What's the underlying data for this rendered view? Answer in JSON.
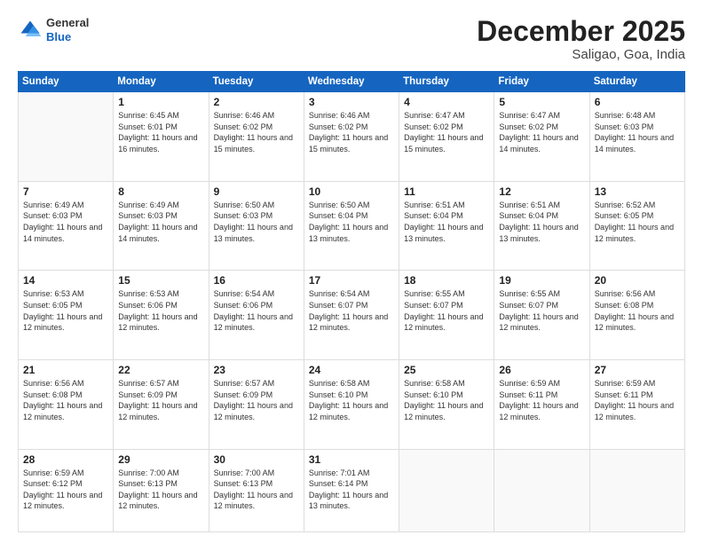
{
  "header": {
    "logo": {
      "general": "General",
      "blue": "Blue"
    },
    "title": "December 2025",
    "location": "Saligao, Goa, India"
  },
  "days_of_week": [
    "Sunday",
    "Monday",
    "Tuesday",
    "Wednesday",
    "Thursday",
    "Friday",
    "Saturday"
  ],
  "weeks": [
    [
      {
        "day": "",
        "sunrise": "",
        "sunset": "",
        "daylight": ""
      },
      {
        "day": "1",
        "sunrise": "Sunrise: 6:45 AM",
        "sunset": "Sunset: 6:01 PM",
        "daylight": "Daylight: 11 hours and 16 minutes."
      },
      {
        "day": "2",
        "sunrise": "Sunrise: 6:46 AM",
        "sunset": "Sunset: 6:02 PM",
        "daylight": "Daylight: 11 hours and 15 minutes."
      },
      {
        "day": "3",
        "sunrise": "Sunrise: 6:46 AM",
        "sunset": "Sunset: 6:02 PM",
        "daylight": "Daylight: 11 hours and 15 minutes."
      },
      {
        "day": "4",
        "sunrise": "Sunrise: 6:47 AM",
        "sunset": "Sunset: 6:02 PM",
        "daylight": "Daylight: 11 hours and 15 minutes."
      },
      {
        "day": "5",
        "sunrise": "Sunrise: 6:47 AM",
        "sunset": "Sunset: 6:02 PM",
        "daylight": "Daylight: 11 hours and 14 minutes."
      },
      {
        "day": "6",
        "sunrise": "Sunrise: 6:48 AM",
        "sunset": "Sunset: 6:03 PM",
        "daylight": "Daylight: 11 hours and 14 minutes."
      }
    ],
    [
      {
        "day": "7",
        "sunrise": "Sunrise: 6:49 AM",
        "sunset": "Sunset: 6:03 PM",
        "daylight": "Daylight: 11 hours and 14 minutes."
      },
      {
        "day": "8",
        "sunrise": "Sunrise: 6:49 AM",
        "sunset": "Sunset: 6:03 PM",
        "daylight": "Daylight: 11 hours and 14 minutes."
      },
      {
        "day": "9",
        "sunrise": "Sunrise: 6:50 AM",
        "sunset": "Sunset: 6:03 PM",
        "daylight": "Daylight: 11 hours and 13 minutes."
      },
      {
        "day": "10",
        "sunrise": "Sunrise: 6:50 AM",
        "sunset": "Sunset: 6:04 PM",
        "daylight": "Daylight: 11 hours and 13 minutes."
      },
      {
        "day": "11",
        "sunrise": "Sunrise: 6:51 AM",
        "sunset": "Sunset: 6:04 PM",
        "daylight": "Daylight: 11 hours and 13 minutes."
      },
      {
        "day": "12",
        "sunrise": "Sunrise: 6:51 AM",
        "sunset": "Sunset: 6:04 PM",
        "daylight": "Daylight: 11 hours and 13 minutes."
      },
      {
        "day": "13",
        "sunrise": "Sunrise: 6:52 AM",
        "sunset": "Sunset: 6:05 PM",
        "daylight": "Daylight: 11 hours and 12 minutes."
      }
    ],
    [
      {
        "day": "14",
        "sunrise": "Sunrise: 6:53 AM",
        "sunset": "Sunset: 6:05 PM",
        "daylight": "Daylight: 11 hours and 12 minutes."
      },
      {
        "day": "15",
        "sunrise": "Sunrise: 6:53 AM",
        "sunset": "Sunset: 6:06 PM",
        "daylight": "Daylight: 11 hours and 12 minutes."
      },
      {
        "day": "16",
        "sunrise": "Sunrise: 6:54 AM",
        "sunset": "Sunset: 6:06 PM",
        "daylight": "Daylight: 11 hours and 12 minutes."
      },
      {
        "day": "17",
        "sunrise": "Sunrise: 6:54 AM",
        "sunset": "Sunset: 6:07 PM",
        "daylight": "Daylight: 11 hours and 12 minutes."
      },
      {
        "day": "18",
        "sunrise": "Sunrise: 6:55 AM",
        "sunset": "Sunset: 6:07 PM",
        "daylight": "Daylight: 11 hours and 12 minutes."
      },
      {
        "day": "19",
        "sunrise": "Sunrise: 6:55 AM",
        "sunset": "Sunset: 6:07 PM",
        "daylight": "Daylight: 11 hours and 12 minutes."
      },
      {
        "day": "20",
        "sunrise": "Sunrise: 6:56 AM",
        "sunset": "Sunset: 6:08 PM",
        "daylight": "Daylight: 11 hours and 12 minutes."
      }
    ],
    [
      {
        "day": "21",
        "sunrise": "Sunrise: 6:56 AM",
        "sunset": "Sunset: 6:08 PM",
        "daylight": "Daylight: 11 hours and 12 minutes."
      },
      {
        "day": "22",
        "sunrise": "Sunrise: 6:57 AM",
        "sunset": "Sunset: 6:09 PM",
        "daylight": "Daylight: 11 hours and 12 minutes."
      },
      {
        "day": "23",
        "sunrise": "Sunrise: 6:57 AM",
        "sunset": "Sunset: 6:09 PM",
        "daylight": "Daylight: 11 hours and 12 minutes."
      },
      {
        "day": "24",
        "sunrise": "Sunrise: 6:58 AM",
        "sunset": "Sunset: 6:10 PM",
        "daylight": "Daylight: 11 hours and 12 minutes."
      },
      {
        "day": "25",
        "sunrise": "Sunrise: 6:58 AM",
        "sunset": "Sunset: 6:10 PM",
        "daylight": "Daylight: 11 hours and 12 minutes."
      },
      {
        "day": "26",
        "sunrise": "Sunrise: 6:59 AM",
        "sunset": "Sunset: 6:11 PM",
        "daylight": "Daylight: 11 hours and 12 minutes."
      },
      {
        "day": "27",
        "sunrise": "Sunrise: 6:59 AM",
        "sunset": "Sunset: 6:11 PM",
        "daylight": "Daylight: 11 hours and 12 minutes."
      }
    ],
    [
      {
        "day": "28",
        "sunrise": "Sunrise: 6:59 AM",
        "sunset": "Sunset: 6:12 PM",
        "daylight": "Daylight: 11 hours and 12 minutes."
      },
      {
        "day": "29",
        "sunrise": "Sunrise: 7:00 AM",
        "sunset": "Sunset: 6:13 PM",
        "daylight": "Daylight: 11 hours and 12 minutes."
      },
      {
        "day": "30",
        "sunrise": "Sunrise: 7:00 AM",
        "sunset": "Sunset: 6:13 PM",
        "daylight": "Daylight: 11 hours and 12 minutes."
      },
      {
        "day": "31",
        "sunrise": "Sunrise: 7:01 AM",
        "sunset": "Sunset: 6:14 PM",
        "daylight": "Daylight: 11 hours and 13 minutes."
      },
      {
        "day": "",
        "sunrise": "",
        "sunset": "",
        "daylight": ""
      },
      {
        "day": "",
        "sunrise": "",
        "sunset": "",
        "daylight": ""
      },
      {
        "day": "",
        "sunrise": "",
        "sunset": "",
        "daylight": ""
      }
    ]
  ]
}
